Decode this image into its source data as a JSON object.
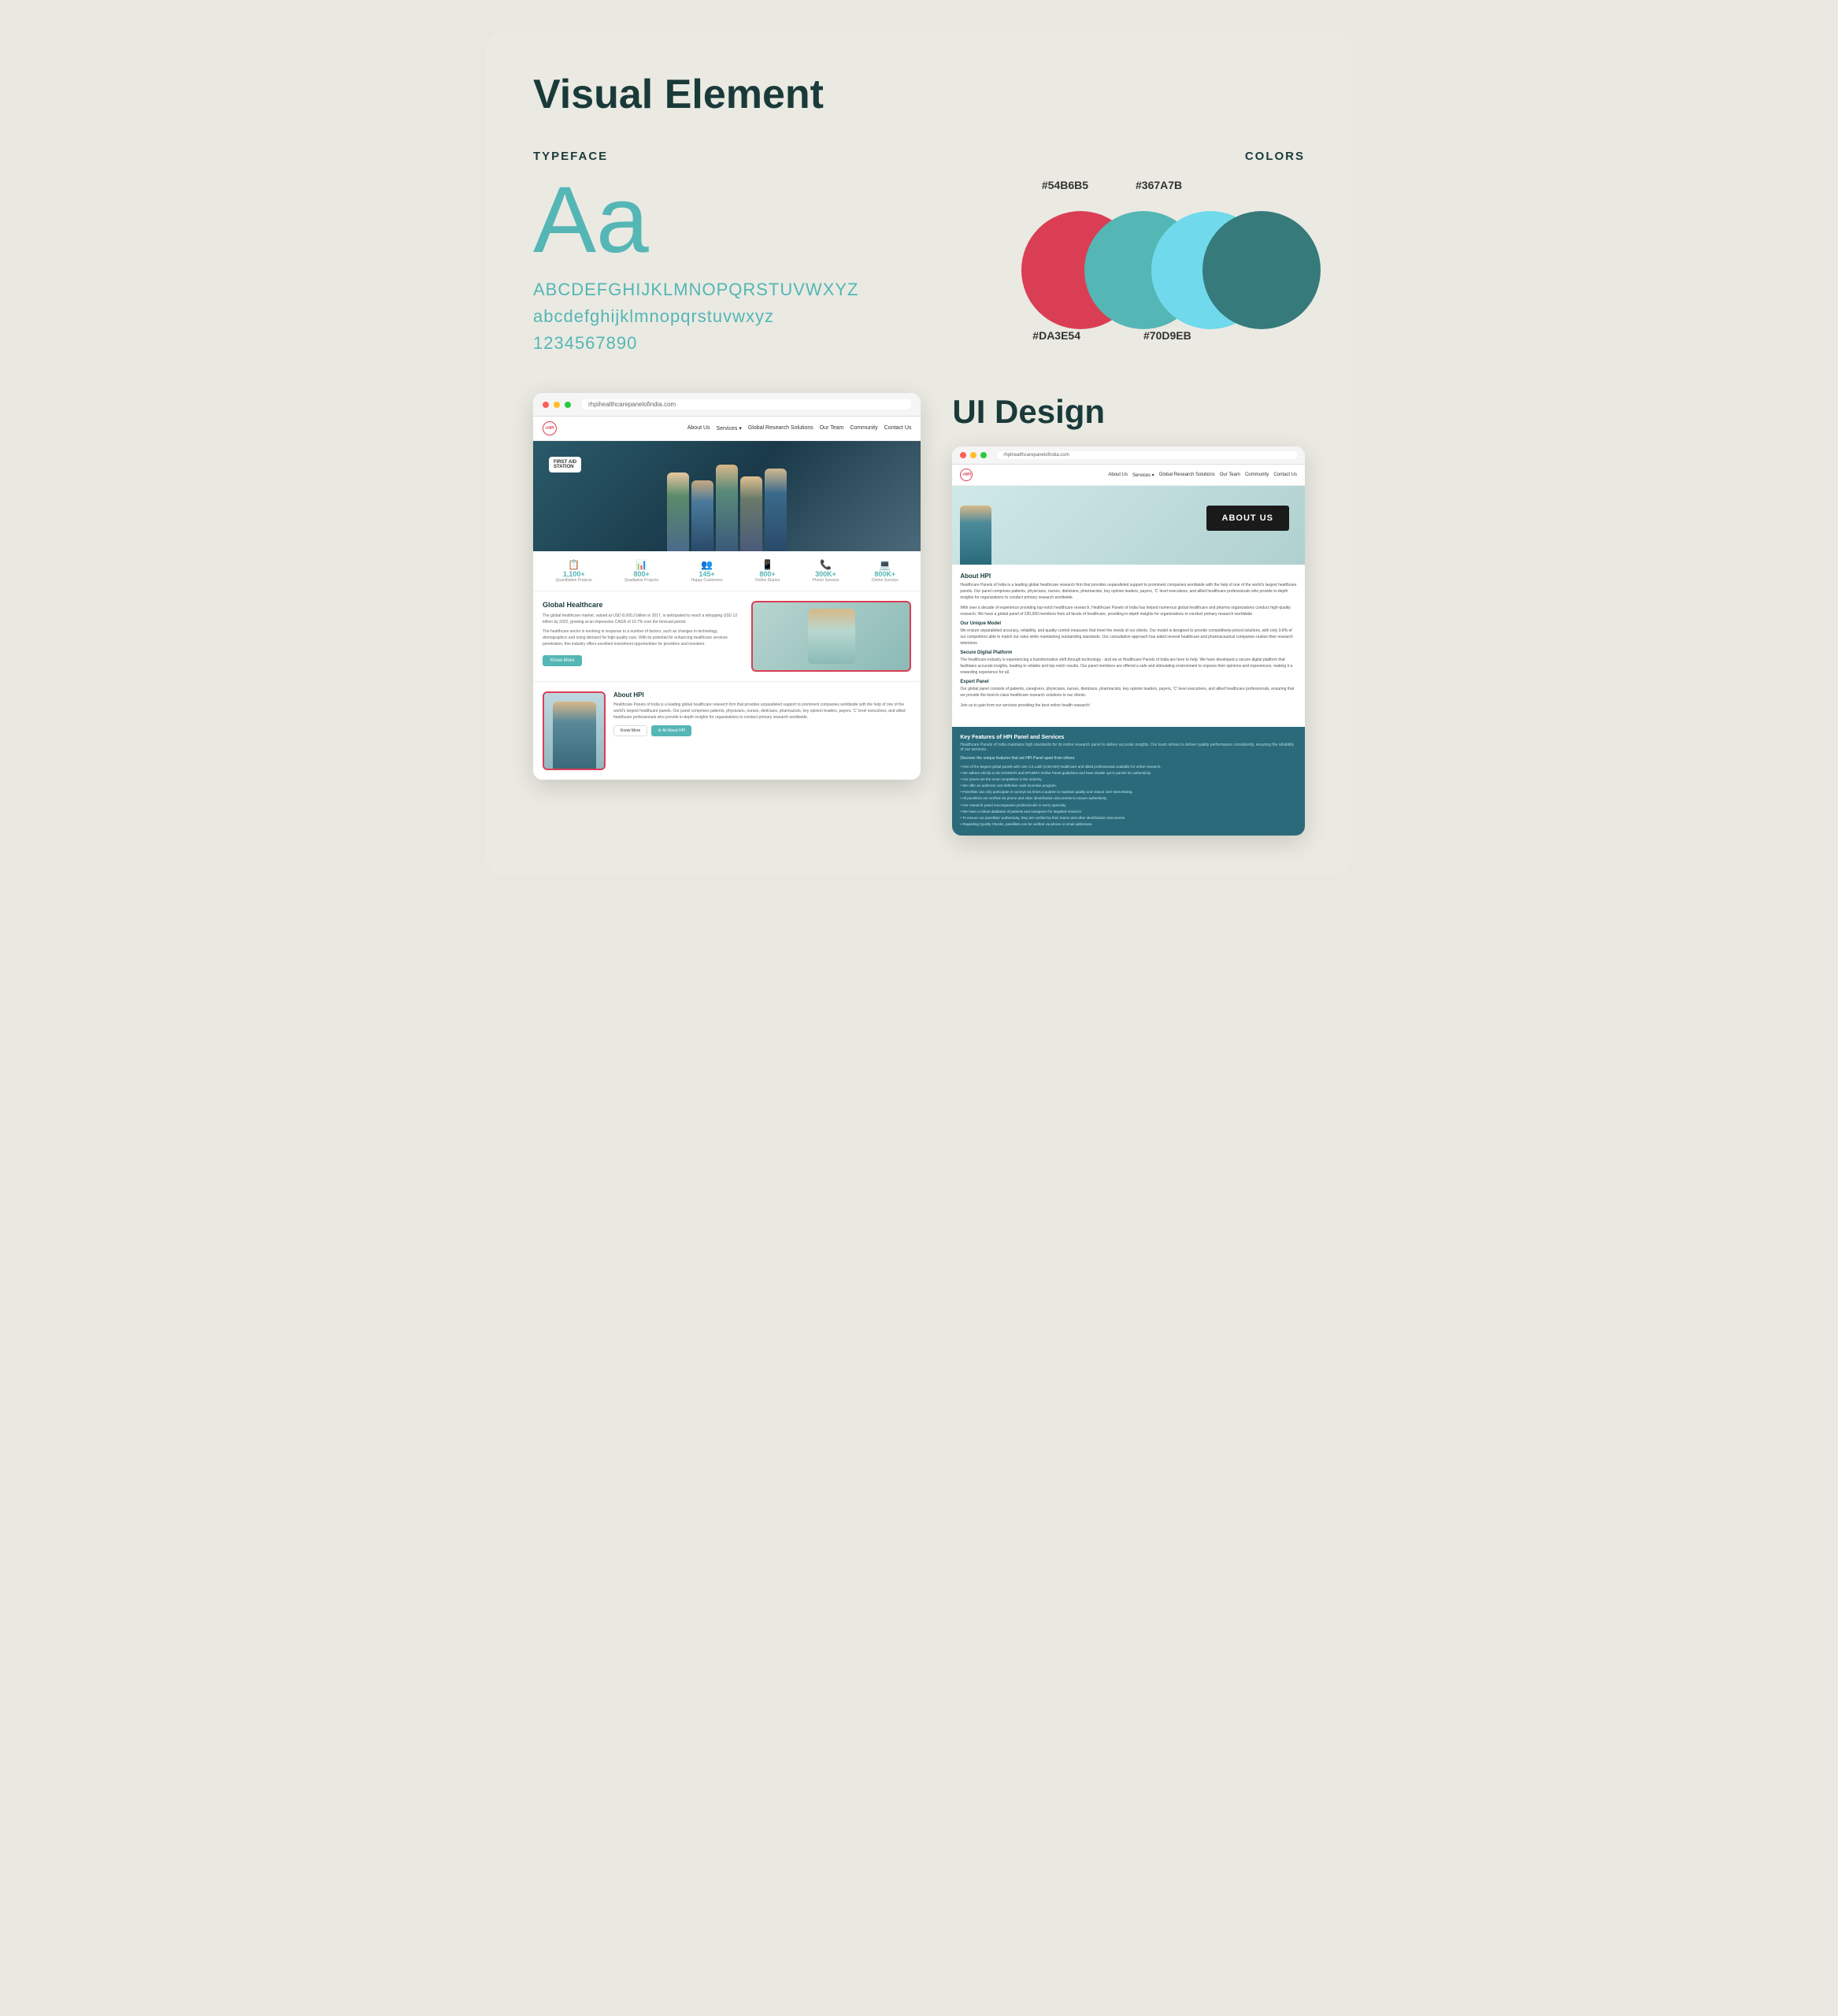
{
  "page": {
    "title": "Visual Element",
    "background_color": "#e8e8e0"
  },
  "typeface": {
    "label": "TYPEFACE",
    "big_letters": "Aa",
    "uppercase": "ABCDEFGHIJKLMNOPQRSTUVWXYZ",
    "lowercase": "abcdefghijklmnopqrstuvwxyz",
    "numbers": "1234567890",
    "color": "#54b6b5"
  },
  "colors": {
    "label": "COLORS",
    "swatches": [
      {
        "hex": "#DA3E54",
        "label": "#DA3E54",
        "name": "red"
      },
      {
        "hex": "#54B6B5",
        "label": "#54B6B5",
        "name": "teal"
      },
      {
        "hex": "#70D9EB",
        "label": "#70D9EB",
        "name": "light-blue"
      },
      {
        "hex": "#367A7B",
        "label": "#367A7B",
        "name": "dark-teal"
      }
    ],
    "top_labels": [
      "#54B6B5",
      "#367A7B"
    ],
    "bottom_labels": [
      "#DA3E54",
      "#70D9EB"
    ]
  },
  "left_screenshot": {
    "nav": {
      "logo": "+HPI",
      "links": [
        "About Us",
        "Services ▾",
        "Global Research Solutions",
        "Our Team",
        "Community",
        "Contact Us"
      ]
    },
    "hero_first_aid": "FIRST AID\nSTATION",
    "stats": [
      {
        "icon": "📋",
        "number": "1,100+",
        "label": "Quantitative Projects"
      },
      {
        "icon": "📊",
        "number": "800+",
        "label": "Qualitative Projects"
      },
      {
        "icon": "👥",
        "number": "145+",
        "label": "Happy Customers"
      },
      {
        "icon": "📱",
        "number": "800+",
        "label": "Online Diaries"
      },
      {
        "icon": "📞",
        "number": "300K+",
        "label": "Phone Surveys"
      },
      {
        "icon": "💻",
        "number": "800K+",
        "label": "Online Surveys"
      }
    ],
    "global_healthcare": {
      "heading": "Global Healthcare",
      "text1": "The global healthcare market, valued at USD 8,000.3 billion in 2017, is anticipated to reach a whopping USD 12 trillion by 2022, growing at an impressive CAGR of 10.7% over the forecast period.",
      "text2": "The healthcare sector is evolving in response to a number of factors, such as changes in technology, demographics and rising demand for high-quality care. With its potential for enhancing healthcare services penetration, this industry offers excellent investment opportunities for providers and investors.",
      "button": "Know More"
    },
    "about_hpi": {
      "heading": "About HPI",
      "text": "Healthcare Panels of India is a leading global healthcare research firm that provides unparalleled support to prominent companies worldwide with the help of one of the world's largest healthcare panels. Our panel comprises patients, physicians, nurses, dieticians, pharmacists, key opinion leaders, payers, 'C' level executives, and allied healthcare professionals who provide in-depth insights for organizations to conduct primary research worldwide.",
      "button1": "Know More",
      "button2": "⚙ All About HPI"
    }
  },
  "ui_design": {
    "title": "UI Design"
  },
  "right_screenshot": {
    "url": "rhpihealthcarepanelofindia.com",
    "nav": {
      "logo": "+HPI",
      "links": [
        "About Us",
        "Services ▾",
        "Global Research Solutions",
        "Our Team",
        "Community",
        "Contact Us"
      ]
    },
    "about_us_badge": "ABOUT US",
    "about_hpi": {
      "main_title": "About HPI",
      "intro": "Healthcare Panels of India is a leading global healthcare research firm that provides unparalleled support to prominent companies worldwide with the help of one of the world's largest healthcare panels. Our panel comprises patients, physicians, nurses, dieticians, pharmacists, key opinion leaders, payers, 'C' level executives, and allied healthcare professionals who provide in-depth insights for organizations to conduct primary research worldwide.",
      "second_para": "With over a decade of experience providing top-notch healthcare research, Healthcare Panels of India has helped numerous global healthcare and pharma organizations conduct high-quality research. We have a global panel of 230,000 members from all facets of healthcare, providing in-depth insights for organizations to conduct primary research worldwide.",
      "unique_model_title": "Our Unique Model",
      "unique_model_text": "We ensure unparalleled accuracy, reliability, and quality control measures that meet the needs of our clients. Our model is designed to provide competitively-priced solutions, with only 3-8% of our competitors able to match our rates while maintaining outstanding standards. Our consultative approach has aided several healthcare and pharmaceutical companies realize their research intentions.",
      "digital_title": "Secure Digital Platform",
      "digital_text": "The healthcare industry is experiencing a transformative shift through technology - and we at Healthcare Panels of India are here to help. We have developed a secure digital platform that facilitates accurate insights, leading to reliable and top-notch results. Our panel members are offered a safe and stimulating environment to express their opinions and experiences, making it a rewarding experience for all.",
      "expert_title": "Expert Panel",
      "expert_text": "Our global panel consists of patients, caregivers, physicians, nurses, dieticians, pharmacists, key opinion leaders, payers, 'C' level executives, and allied healthcare professionals, ensuring that we provide the best-in-class healthcare research solutions to our clients.",
      "join_text": "Join us to gain from our services providing the best online health research!"
    },
    "key_features": {
      "title": "Key Features of HPI Panel and Services",
      "subtitle": "Healthcare Panels of India maintains high standards for its online research panel to deliver accurate insights. Our team strives to deliver quality performance consistently, ensuring the reliability of our services.",
      "discover": "Discover the unique features that set HPI Panel apart from others:",
      "items": [
        "One of the largest global panels with over 2.5 Lakh (2,50,000) healthcare and allied professionals available for online research.",
        "We adhere strictly to the ESOMAR and EPHMRA Online Panel guidelines and have double opt-in panels for authenticity.",
        "Our prices are the most competitive in the industry.",
        "We offer an authentic and definitive cash-incentive program.",
        "Panellists can only participate in surveys six times a quarter to maintain quality and reduce over-interviewing.",
        "All panellists are verified via phone and other identification documents to ensure authenticity.",
        "Our research panel encompasses professionals in every specialty.",
        "We have a robust database of patients and caregivers for targeted research.",
        "To ensure our panellists' authenticity, they are verified by their teams and other identification documents.",
        "Regarding Quality Checks, panellists can be verified via phone or email addresses."
      ]
    }
  }
}
